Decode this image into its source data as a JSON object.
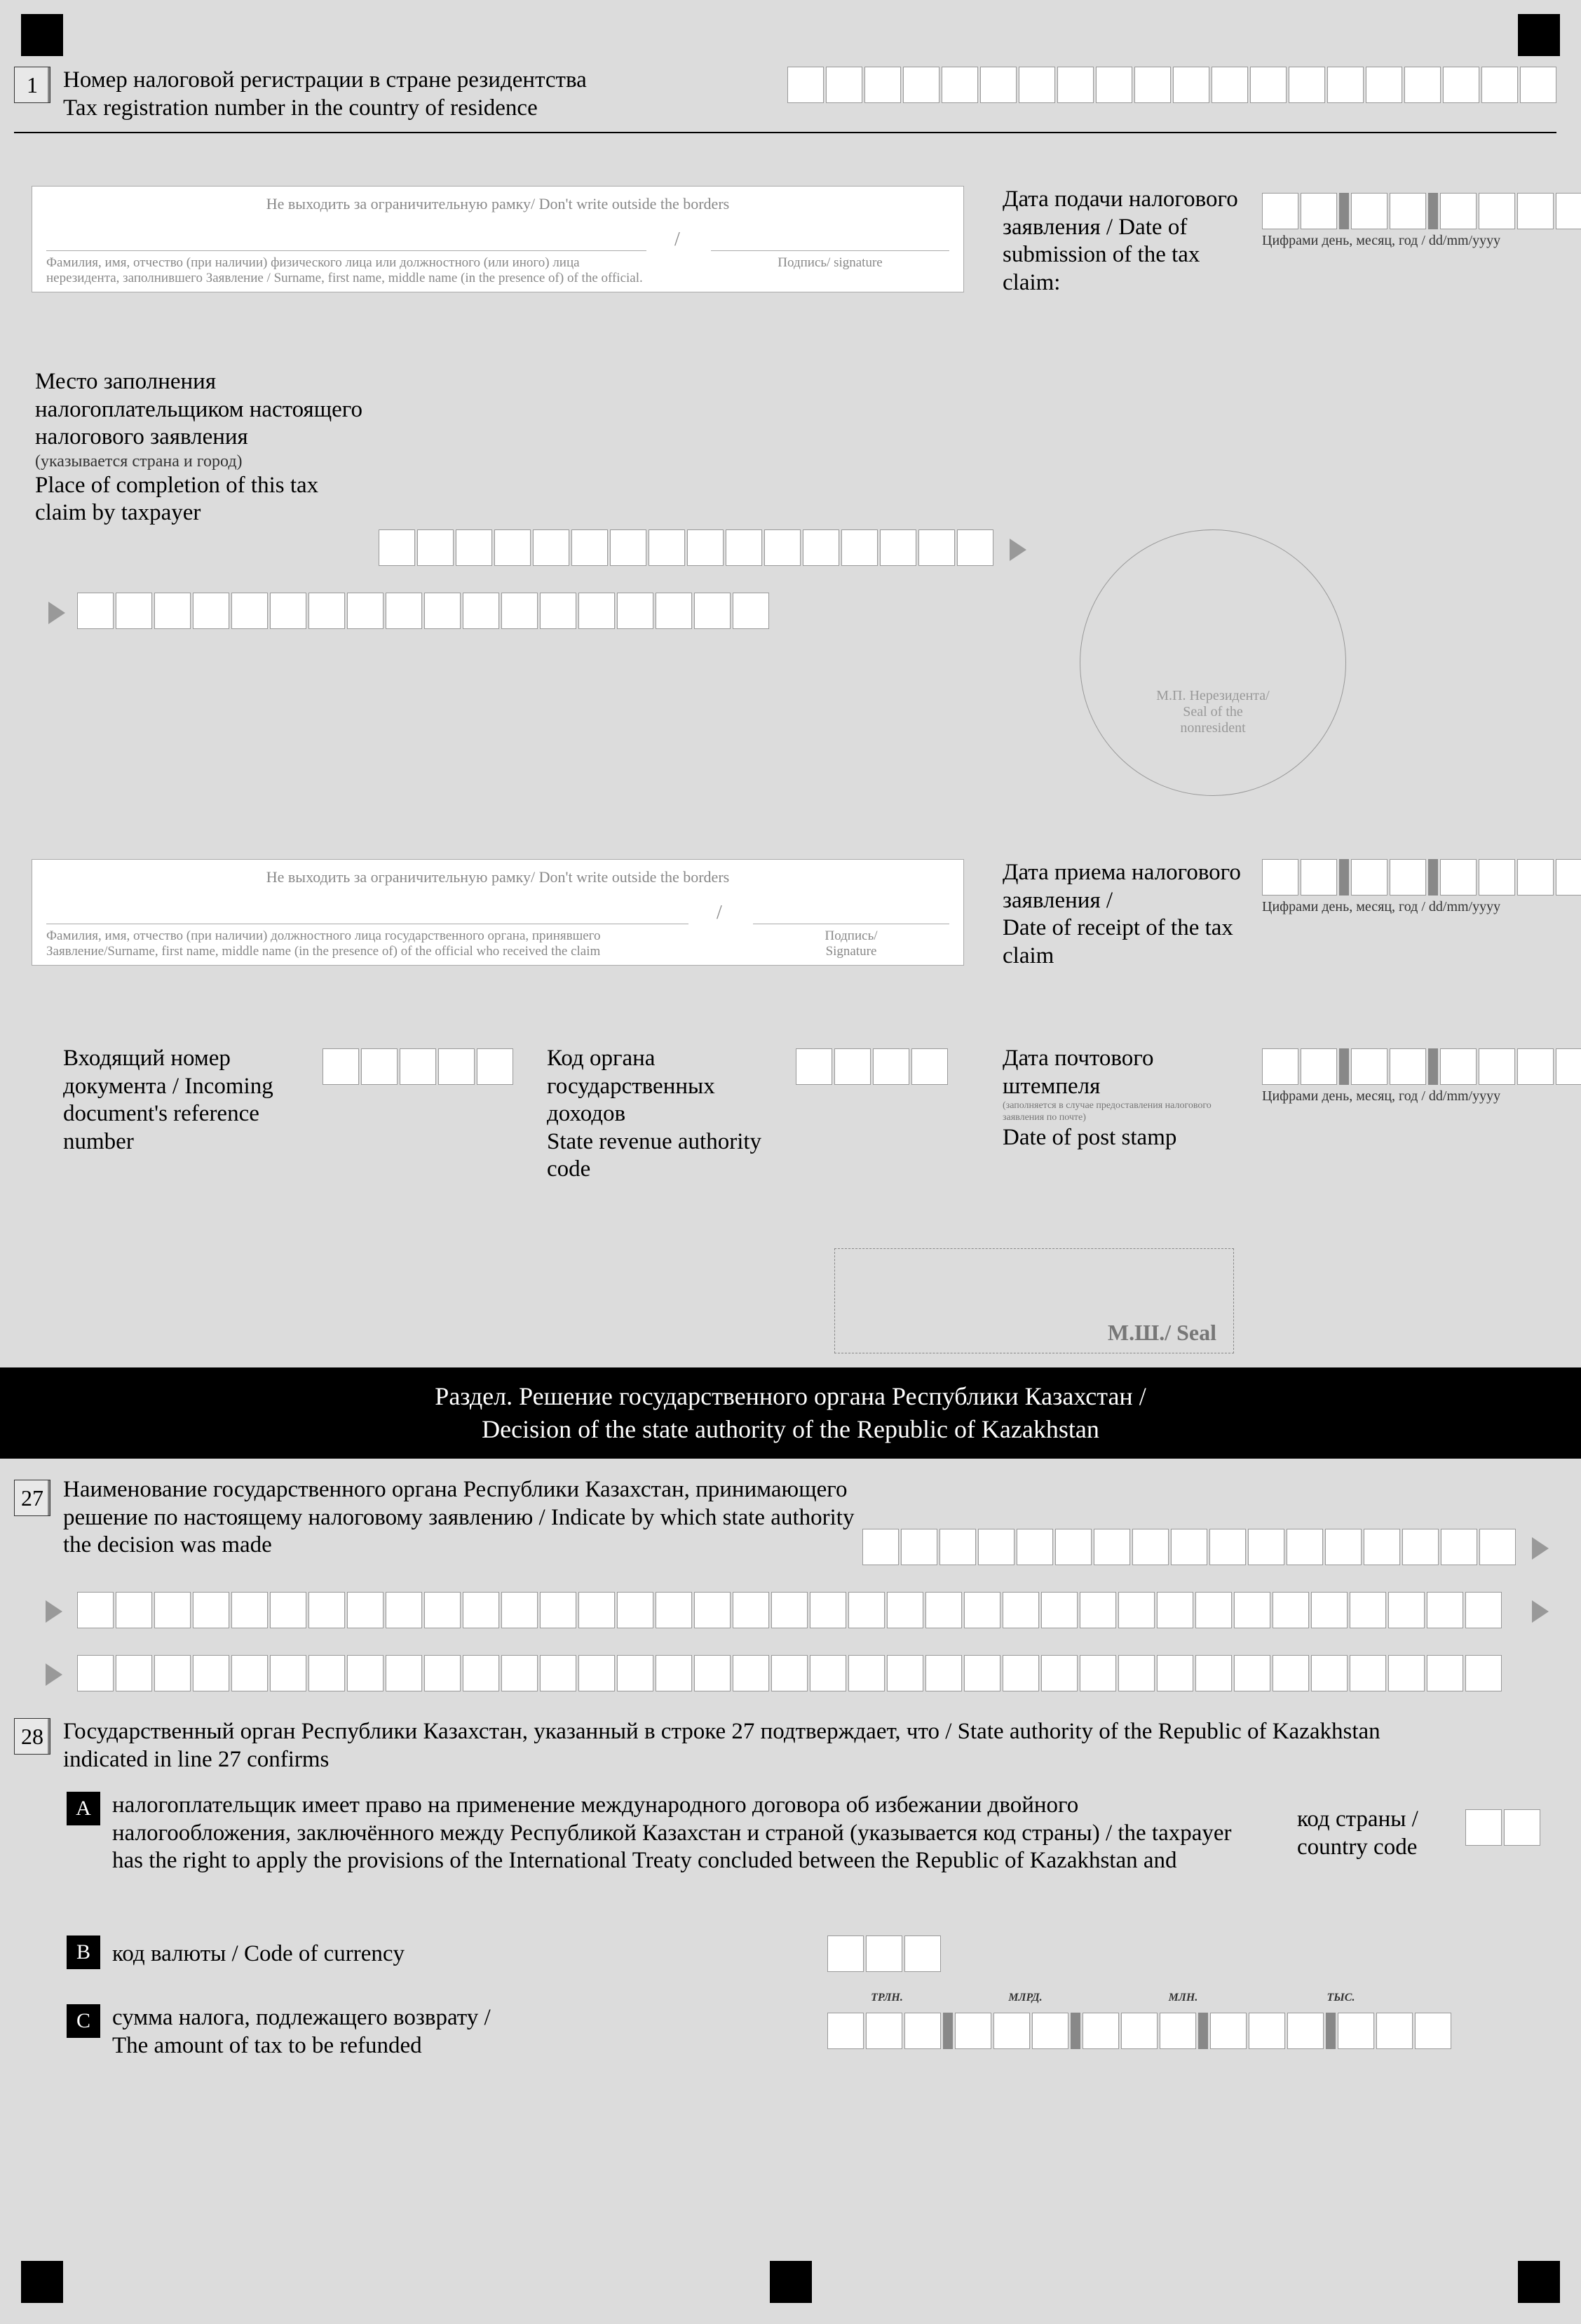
{
  "section1": {
    "num": "1",
    "title_ru": "Номер налоговой регистрации в стране резидентства",
    "title_en": "Tax registration number in the country of residence"
  },
  "borders_hint": "Не выходить за ограничительную рамку/ Don't write outside the borders",
  "sig1": {
    "desc": "Фамилия, имя, отчество (при наличии) физического лица или должностного (или иного) лица нерезидента, заполнившего Заявление / Surname, first name, middle name  (in the presence of) of the official.",
    "signature": "Подпись/ signature"
  },
  "date_submit": {
    "label": "Дата подачи налогового заявления / Date of submission of the tax claim:",
    "hint": "Цифрами день, месяц, год / dd/mm/yyyy"
  },
  "place": {
    "label_ru": "Место заполнения налогоплательщиком настоящего налогового заявления",
    "label_note": "(указывается страна и город)",
    "label_en": "Place of completion of this tax claim by taxpayer"
  },
  "seal_nonres": "М.П. Нерезидента/\nSeal of the\nnonresident",
  "sig2": {
    "desc": "Фамилия, имя, отчество (при наличии) должностного лица государственного органа, принявшего Заявление/Surname, first name, middle name  (in the presence of) of the official who received the claim",
    "signature": "Подпись/\nSignature"
  },
  "date_receipt": {
    "label": "Дата приема налогового заявления / \nDate of receipt of the tax claim",
    "hint": "Цифрами день, месяц, год / dd/mm/yyyy"
  },
  "incoming": {
    "label": "Входящий номер документа / Incoming document's reference number"
  },
  "revenue": {
    "label": "Код органа государственных доходов\nState revenue authority code"
  },
  "poststamp": {
    "label_ru": "Дата почтового штемпеля",
    "note": "(заполняется в случае предоставления налогового заявления по почте)",
    "label_en": "Date of post stamp",
    "hint": "Цифрами день, месяц, год / dd/mm/yyyy"
  },
  "seal2": "М.Ш./ Seal",
  "blackbar": {
    "ru": "Раздел. Решение государственного органа Республики Казахстан /",
    "en": "Decision of the state authority of the Republic of Kazakhstan"
  },
  "s27": {
    "num": "27",
    "label": "Наименование государственного органа Республики Казахстан, принимающего решение по настоящему налоговому заявлению / Indicate by which state authority the decision was made"
  },
  "s28": {
    "num": "28",
    "label": "Государственный орган Республики Казахстан, указанный в строке 27 подтверждает, что / State authority of the Republic of Kazakhstan indicated in line 27 confirms",
    "A": {
      "mark": "A",
      "text": "налогоплательщик имеет право на применение международного договора об избежании двойного налогообложения, заключённого между Республикой Казахстан и страной (указывается код страны) / the taxpayer has the right to apply the provisions of the International Treaty concluded between the Republic of Kazakhstan and",
      "country": "код страны / country code"
    },
    "B": {
      "mark": "B",
      "text": "код валюты / Code of currency"
    },
    "C": {
      "mark": "C",
      "text": "сумма налога, подлежащего возврату / \nThe amount of tax to be refunded"
    },
    "money_labels": [
      "ТРЛН.",
      "МЛРД.",
      "МЛН.",
      "ТЫС."
    ]
  }
}
